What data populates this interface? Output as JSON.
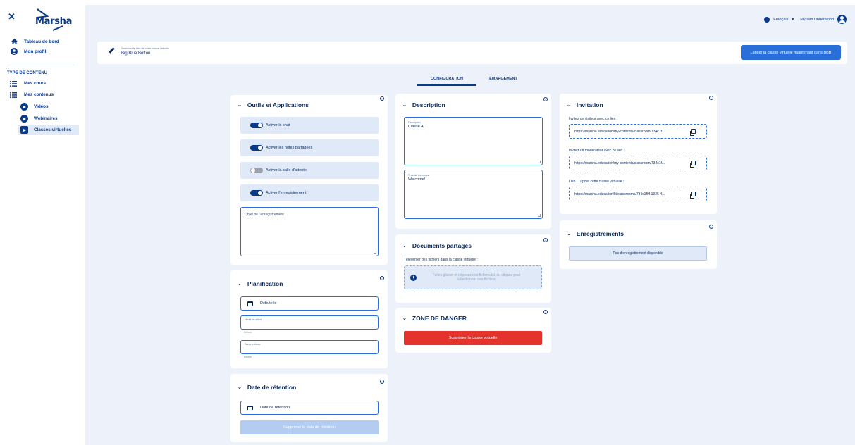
{
  "sidebar": {
    "logo_text": "Marsha",
    "nav": [
      {
        "label": "Tableau de bord",
        "icon": "home-icon"
      },
      {
        "label": "Mon profil",
        "icon": "user-icon"
      }
    ],
    "section_title": "TYPE DE CONTENU",
    "items": [
      {
        "label": "Mes cours",
        "icon": "list-icon"
      },
      {
        "label": "Mes contenus",
        "icon": "list-icon"
      },
      {
        "label": "Vidéos",
        "icon": "play-icon"
      },
      {
        "label": "Webinaires",
        "icon": "webinar-icon"
      },
      {
        "label": "Classes virtuelles",
        "icon": "classroom-icon",
        "active": true
      }
    ]
  },
  "topbar": {
    "language": "Français",
    "user_name": "Myriam Underwood"
  },
  "header": {
    "title_hint": "Saisissez le titre de votre classe virtuelle",
    "title_value": "Big Blue Botton",
    "launch_button": "Lancer la classe virtuelle maintenant dans BBB"
  },
  "tabs": [
    {
      "label": "CONFIGURATION",
      "active": true
    },
    {
      "label": "ÉMARGEMENT",
      "active": false
    }
  ],
  "tools": {
    "title": "Outils et Applications",
    "toggles": [
      {
        "label": "Activer le chat",
        "on": true
      },
      {
        "label": "Activer les notes partagées",
        "on": true
      },
      {
        "label": "Activer la salle d'attente",
        "on": false
      },
      {
        "label": "Activer l'enregistrement",
        "on": true
      }
    ],
    "recording_placeholder": "Objet de l'enregistrement"
  },
  "planning": {
    "title": "Planification",
    "start_date": "Débute le",
    "start_time_label": "Heure de début",
    "start_time_hint": "hh:mm",
    "duration_label": "Durée estimée",
    "duration_hint": "hh:mm"
  },
  "retention": {
    "title": "Date de rétention",
    "date_placeholder": "Date de rétention",
    "delete_button": "Supprimer la date de rétention"
  },
  "description": {
    "title": "Description",
    "description_label": "Description",
    "description_value": "Classe A",
    "welcome_label": "Texte de bienvenue",
    "welcome_value": "Welcome!"
  },
  "documents": {
    "title": "Documents partagés",
    "upload_label": "Téléverser des fichiers dans la classe virtuelle :",
    "dropzone_text": "Faites glisser et déposez des fichiers ici, ou cliquez pour sélectionner des fichiers"
  },
  "danger": {
    "title": "ZONE DE DANGER",
    "delete_button": "Supprimer la classe virtuelle"
  },
  "invitation": {
    "title": "Invitation",
    "links": [
      {
        "label": "Invitez un visiteur avec ce lien :",
        "url": "https://marsha.education/my-contents/classroom/734c1f..."
      },
      {
        "label": "Invitez un modérateur avec ce lien :",
        "url": "https://marsha.education/my-contents/classroom/734c1f..."
      },
      {
        "label": "Lien LTI pour cette classe virtuelle :",
        "url": "https://marsha.education/lti/classrooms/734c1f0f-1936-4..."
      }
    ]
  },
  "recordings": {
    "title": "Enregistrements",
    "empty_text": "Pas d'enregistrement disponible"
  },
  "colors": {
    "primary": "#0a3a8a",
    "accent": "#2a6ed9",
    "danger": "#e3332c",
    "background": "#edf2fa"
  }
}
